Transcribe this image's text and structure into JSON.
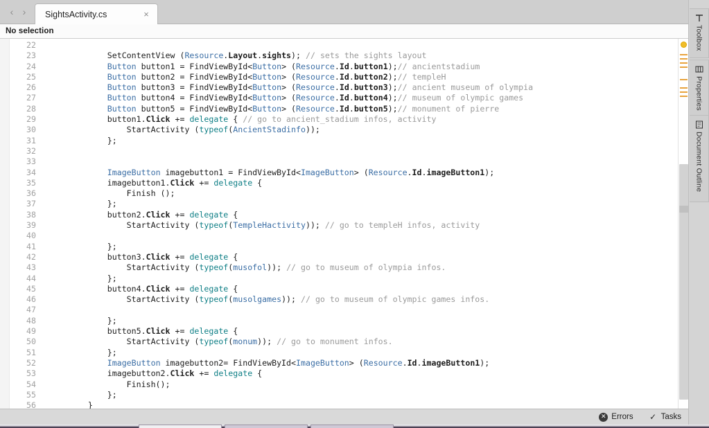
{
  "tabbar": {
    "back_label": "‹",
    "forward_label": "›",
    "tab_title": "SightsActivity.cs",
    "close_label": "×",
    "dropdown_label": "▼"
  },
  "pathbar": {
    "selection_text": "No selection"
  },
  "editor": {
    "first_line": 22,
    "lines": [
      {
        "n": 22,
        "tokens": []
      },
      {
        "n": 23,
        "tokens": [
          {
            "t": "p",
            "s": "            SetContentView ("
          },
          {
            "t": "t",
            "s": "Resource"
          },
          {
            "t": "p",
            "s": "."
          },
          {
            "t": "id",
            "s": "Layout"
          },
          {
            "t": "p",
            "s": "."
          },
          {
            "t": "id",
            "s": "sights"
          },
          {
            "t": "p",
            "s": "); "
          },
          {
            "t": "c",
            "s": "// sets the sights layout"
          }
        ]
      },
      {
        "n": 24,
        "tokens": [
          {
            "t": "p",
            "s": "            "
          },
          {
            "t": "t",
            "s": "Button"
          },
          {
            "t": "p",
            "s": " button1 = FindViewById<"
          },
          {
            "t": "t",
            "s": "Button"
          },
          {
            "t": "p",
            "s": "> ("
          },
          {
            "t": "t",
            "s": "Resource"
          },
          {
            "t": "p",
            "s": "."
          },
          {
            "t": "id",
            "s": "Id"
          },
          {
            "t": "p",
            "s": "."
          },
          {
            "t": "id",
            "s": "button1"
          },
          {
            "t": "p",
            "s": ");"
          },
          {
            "t": "c",
            "s": "// ancientstadium"
          }
        ]
      },
      {
        "n": 25,
        "tokens": [
          {
            "t": "p",
            "s": "            "
          },
          {
            "t": "t",
            "s": "Button"
          },
          {
            "t": "p",
            "s": " button2 = FindViewById<"
          },
          {
            "t": "t",
            "s": "Button"
          },
          {
            "t": "p",
            "s": "> ("
          },
          {
            "t": "t",
            "s": "Resource"
          },
          {
            "t": "p",
            "s": "."
          },
          {
            "t": "id",
            "s": "Id"
          },
          {
            "t": "p",
            "s": "."
          },
          {
            "t": "id",
            "s": "button2"
          },
          {
            "t": "p",
            "s": ");"
          },
          {
            "t": "c",
            "s": "// templeH"
          }
        ]
      },
      {
        "n": 26,
        "tokens": [
          {
            "t": "p",
            "s": "            "
          },
          {
            "t": "t",
            "s": "Button"
          },
          {
            "t": "p",
            "s": " button3 = FindViewById<"
          },
          {
            "t": "t",
            "s": "Button"
          },
          {
            "t": "p",
            "s": "> ("
          },
          {
            "t": "t",
            "s": "Resource"
          },
          {
            "t": "p",
            "s": "."
          },
          {
            "t": "id",
            "s": "Id"
          },
          {
            "t": "p",
            "s": "."
          },
          {
            "t": "id",
            "s": "button3"
          },
          {
            "t": "p",
            "s": ");"
          },
          {
            "t": "c",
            "s": "// ancient museum of olympia"
          }
        ]
      },
      {
        "n": 27,
        "tokens": [
          {
            "t": "p",
            "s": "            "
          },
          {
            "t": "t",
            "s": "Button"
          },
          {
            "t": "p",
            "s": " button4 = FindViewById<"
          },
          {
            "t": "t",
            "s": "Button"
          },
          {
            "t": "p",
            "s": "> ("
          },
          {
            "t": "t",
            "s": "Resource"
          },
          {
            "t": "p",
            "s": "."
          },
          {
            "t": "id",
            "s": "Id"
          },
          {
            "t": "p",
            "s": "."
          },
          {
            "t": "id",
            "s": "button4"
          },
          {
            "t": "p",
            "s": ");"
          },
          {
            "t": "c",
            "s": "// museum of olympic games"
          }
        ]
      },
      {
        "n": 28,
        "tokens": [
          {
            "t": "p",
            "s": "            "
          },
          {
            "t": "t",
            "s": "Button"
          },
          {
            "t": "p",
            "s": " button5 = FindViewById<"
          },
          {
            "t": "t",
            "s": "Button"
          },
          {
            "t": "p",
            "s": "> ("
          },
          {
            "t": "t",
            "s": "Resource"
          },
          {
            "t": "p",
            "s": "."
          },
          {
            "t": "id",
            "s": "Id"
          },
          {
            "t": "p",
            "s": "."
          },
          {
            "t": "id",
            "s": "button5"
          },
          {
            "t": "p",
            "s": ");"
          },
          {
            "t": "c",
            "s": "// monument of pierre"
          }
        ]
      },
      {
        "n": 29,
        "tokens": [
          {
            "t": "p",
            "s": "            button1."
          },
          {
            "t": "id",
            "s": "Click"
          },
          {
            "t": "p",
            "s": " += "
          },
          {
            "t": "k",
            "s": "delegate"
          },
          {
            "t": "p",
            "s": " { "
          },
          {
            "t": "c",
            "s": "// go to ancient_stadium infos, activity"
          }
        ]
      },
      {
        "n": 30,
        "tokens": [
          {
            "t": "p",
            "s": "                StartActivity ("
          },
          {
            "t": "k",
            "s": "typeof"
          },
          {
            "t": "p",
            "s": "("
          },
          {
            "t": "t",
            "s": "AncientStadinfo"
          },
          {
            "t": "p",
            "s": "));"
          }
        ]
      },
      {
        "n": 31,
        "tokens": [
          {
            "t": "p",
            "s": "            };"
          }
        ]
      },
      {
        "n": 32,
        "tokens": []
      },
      {
        "n": 33,
        "tokens": []
      },
      {
        "n": 34,
        "tokens": [
          {
            "t": "p",
            "s": "            "
          },
          {
            "t": "t",
            "s": "ImageButton"
          },
          {
            "t": "p",
            "s": " imagebutton1 = FindViewById<"
          },
          {
            "t": "t",
            "s": "ImageButton"
          },
          {
            "t": "p",
            "s": "> ("
          },
          {
            "t": "t",
            "s": "Resource"
          },
          {
            "t": "p",
            "s": "."
          },
          {
            "t": "id",
            "s": "Id"
          },
          {
            "t": "p",
            "s": "."
          },
          {
            "t": "id",
            "s": "imageButton1"
          },
          {
            "t": "p",
            "s": ");"
          }
        ]
      },
      {
        "n": 35,
        "tokens": [
          {
            "t": "p",
            "s": "            imagebutton1."
          },
          {
            "t": "id",
            "s": "Click"
          },
          {
            "t": "p",
            "s": " += "
          },
          {
            "t": "k",
            "s": "delegate"
          },
          {
            "t": "p",
            "s": " {"
          }
        ]
      },
      {
        "n": 36,
        "tokens": [
          {
            "t": "p",
            "s": "                Finish ();"
          }
        ]
      },
      {
        "n": 37,
        "tokens": [
          {
            "t": "p",
            "s": "            };"
          }
        ]
      },
      {
        "n": 38,
        "tokens": [
          {
            "t": "p",
            "s": "            button2."
          },
          {
            "t": "id",
            "s": "Click"
          },
          {
            "t": "p",
            "s": " += "
          },
          {
            "t": "k",
            "s": "delegate"
          },
          {
            "t": "p",
            "s": " {"
          }
        ]
      },
      {
        "n": 39,
        "tokens": [
          {
            "t": "p",
            "s": "                StartActivity ("
          },
          {
            "t": "k",
            "s": "typeof"
          },
          {
            "t": "p",
            "s": "("
          },
          {
            "t": "t",
            "s": "TempleHactivity"
          },
          {
            "t": "p",
            "s": ")); "
          },
          {
            "t": "c",
            "s": "// go to templeH infos, activity"
          }
        ]
      },
      {
        "n": 40,
        "tokens": []
      },
      {
        "n": 41,
        "tokens": [
          {
            "t": "p",
            "s": "            };"
          }
        ]
      },
      {
        "n": 42,
        "tokens": [
          {
            "t": "p",
            "s": "            button3."
          },
          {
            "t": "id",
            "s": "Click"
          },
          {
            "t": "p",
            "s": " += "
          },
          {
            "t": "k",
            "s": "delegate"
          },
          {
            "t": "p",
            "s": " {"
          }
        ]
      },
      {
        "n": 43,
        "tokens": [
          {
            "t": "p",
            "s": "                StartActivity ("
          },
          {
            "t": "k",
            "s": "typeof"
          },
          {
            "t": "p",
            "s": "("
          },
          {
            "t": "t",
            "s": "musofol"
          },
          {
            "t": "p",
            "s": ")); "
          },
          {
            "t": "c",
            "s": "// go to museum of olympia infos."
          }
        ]
      },
      {
        "n": 44,
        "tokens": [
          {
            "t": "p",
            "s": "            };"
          }
        ]
      },
      {
        "n": 45,
        "tokens": [
          {
            "t": "p",
            "s": "            button4."
          },
          {
            "t": "id",
            "s": "Click"
          },
          {
            "t": "p",
            "s": " += "
          },
          {
            "t": "k",
            "s": "delegate"
          },
          {
            "t": "p",
            "s": " {"
          }
        ]
      },
      {
        "n": 46,
        "tokens": [
          {
            "t": "p",
            "s": "                StartActivity ("
          },
          {
            "t": "k",
            "s": "typeof"
          },
          {
            "t": "p",
            "s": "("
          },
          {
            "t": "t",
            "s": "musolgames"
          },
          {
            "t": "p",
            "s": ")); "
          },
          {
            "t": "c",
            "s": "// go to museum of olympic games infos."
          }
        ]
      },
      {
        "n": 47,
        "tokens": []
      },
      {
        "n": 48,
        "tokens": [
          {
            "t": "p",
            "s": "            };"
          }
        ]
      },
      {
        "n": 49,
        "tokens": [
          {
            "t": "p",
            "s": "            button5."
          },
          {
            "t": "id",
            "s": "Click"
          },
          {
            "t": "p",
            "s": " += "
          },
          {
            "t": "k",
            "s": "delegate"
          },
          {
            "t": "p",
            "s": " {"
          }
        ]
      },
      {
        "n": 50,
        "tokens": [
          {
            "t": "p",
            "s": "                StartActivity ("
          },
          {
            "t": "k",
            "s": "typeof"
          },
          {
            "t": "p",
            "s": "("
          },
          {
            "t": "t",
            "s": "monum"
          },
          {
            "t": "p",
            "s": ")); "
          },
          {
            "t": "c",
            "s": "// go to monument infos."
          }
        ]
      },
      {
        "n": 51,
        "tokens": [
          {
            "t": "p",
            "s": "            };"
          }
        ]
      },
      {
        "n": 52,
        "tokens": [
          {
            "t": "p",
            "s": "            "
          },
          {
            "t": "t",
            "s": "ImageButton"
          },
          {
            "t": "p",
            "s": " imagebutton2= FindViewById<"
          },
          {
            "t": "t",
            "s": "ImageButton"
          },
          {
            "t": "p",
            "s": "> ("
          },
          {
            "t": "t",
            "s": "Resource"
          },
          {
            "t": "p",
            "s": "."
          },
          {
            "t": "id",
            "s": "Id"
          },
          {
            "t": "p",
            "s": "."
          },
          {
            "t": "id",
            "s": "imageButton1"
          },
          {
            "t": "p",
            "s": ");"
          }
        ]
      },
      {
        "n": 53,
        "tokens": [
          {
            "t": "p",
            "s": "            imagebutton2."
          },
          {
            "t": "id",
            "s": "Click"
          },
          {
            "t": "p",
            "s": " += "
          },
          {
            "t": "k",
            "s": "delegate"
          },
          {
            "t": "p",
            "s": " {"
          }
        ]
      },
      {
        "n": 54,
        "tokens": [
          {
            "t": "p",
            "s": "                Finish();"
          }
        ]
      },
      {
        "n": 55,
        "tokens": [
          {
            "t": "p",
            "s": "            };"
          }
        ]
      },
      {
        "n": 56,
        "tokens": [
          {
            "t": "p",
            "s": "        }"
          }
        ]
      }
    ]
  },
  "pads": [
    {
      "label": "Toolbox",
      "icon": "toolbox-icon"
    },
    {
      "label": "Properties",
      "icon": "properties-icon"
    },
    {
      "label": "Document Outline",
      "icon": "document-outline-icon"
    }
  ],
  "statusbar": {
    "errors_label": "Errors",
    "errors_icon": "error-circle-icon",
    "tasks_label": "Tasks",
    "tasks_icon": "checkmark-icon"
  },
  "colors": {
    "type_blue": "#3b6ea5",
    "keyword_teal": "#0f7f86",
    "comment_gray": "#9a9a9a",
    "warning_orange": "#e8a33d",
    "warning_dot": "#f0bd2a",
    "chrome_gray": "#cfcfcf"
  }
}
